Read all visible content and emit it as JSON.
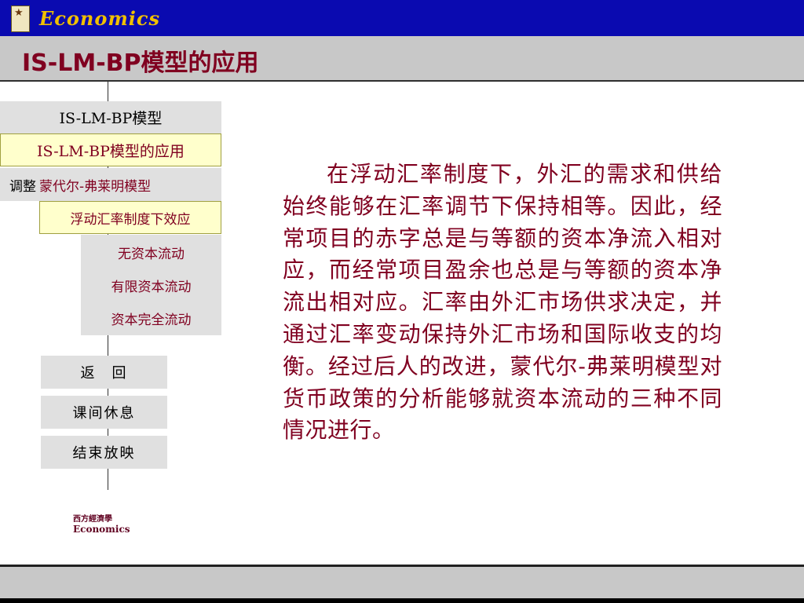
{
  "header": {
    "brand": "Economics",
    "title": "IS-LM-BP模型的应用"
  },
  "nav": {
    "item1": "IS-LM-BP模型",
    "item2": "IS-LM-BP模型的应用",
    "item3_lead": "调整",
    "item3": "蒙代尔-弗莱明模型",
    "item4": "浮动汇率制度下效应",
    "sub1": "无资本流动",
    "sub2": "有限资本流动",
    "sub3": "资本完全流动"
  },
  "buttons": {
    "back": "返　回",
    "break": "课间休息",
    "end": "结束放映"
  },
  "small_logo": {
    "cn": "西方經濟學",
    "en": "Economics"
  },
  "content": {
    "paragraph": "在浮动汇率制度下，外汇的需求和供给始终能够在汇率调节下保持相等。因此，经常项目的赤字总是与等额的资本净流入相对应，而经常项目盈余也总是与等额的资本净流出相对应。汇率由外汇市场供求决定，并通过汇率变动保持外汇市场和国际收支的均衡。经过后人的改进，蒙代尔-弗莱明模型对货币政策的分析能够就资本流动的三种不同情况进行。"
  },
  "colors": {
    "top_bar": "#0a0ab0",
    "brand_text": "#f0c000",
    "accent_text": "#800020",
    "highlight_bg": "#ffffcc",
    "panel_bg": "#e0e0e0"
  }
}
